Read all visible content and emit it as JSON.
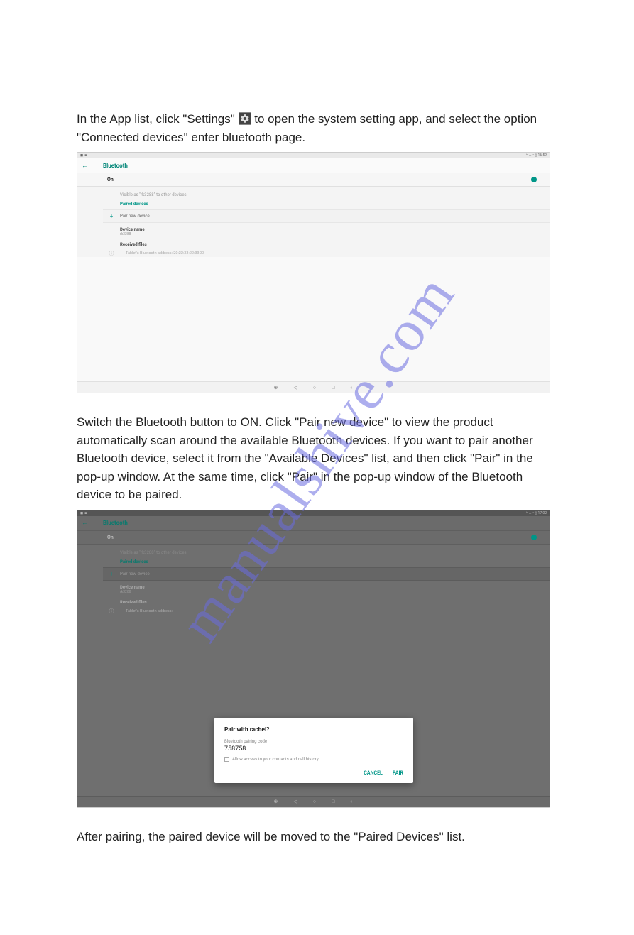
{
  "paragraphs": {
    "p1a": "In the App list, click \"Settings\" ",
    "p1b": " to open the system setting app, and select the option \"Connected devices\" enter bluetooth page.",
    "p2": "Switch the Bluetooth button to ON. Click \"Pair new device\" to view the product automatically scan around the available Bluetooth devices. If you want to pair another Bluetooth device, select it from the \"Available Devices\" list, and then click \"Pair\" in the pop-up window. At the same time, click \"Pair\" in the pop-up window of the Bluetooth device to be paired.",
    "p3": "After pairing, the paired device will be moved to the \"Paired Devices\" list."
  },
  "watermark": "manualshive.com",
  "shot1": {
    "status_time": "16:59",
    "status_ind": "ᵇ ↔ ᶜ ▯",
    "header_title": "Bluetooth",
    "on_label": "On",
    "visible_text": "Visible as \"rk3288\" to other devices",
    "paired_devices_label": "Paired devices",
    "pair_new_device": "Pair new device",
    "device_name_label": "Device name",
    "device_name_value": "rk3288",
    "received_files": "Received files",
    "bt_addr": "Tablet's Bluetooth address: 20:22:33:22:33:33"
  },
  "shot2": {
    "status_time": "17:02",
    "status_ind": "ᵇ ↔ ᶜ ▯",
    "header_title": "Bluetooth",
    "on_label": "On",
    "visible_text": "Visible as \"rk3288\" to other devices",
    "paired_devices_label": "Paired devices",
    "pair_new_device": "Pair new device",
    "device_name_label": "Device name",
    "device_name_value": "rk3288",
    "received_files": "Received files",
    "bt_addr": "Tablet's Bluetooth address:",
    "dialog": {
      "title": "Pair with rachel?",
      "code_label": "Bluetooth pairing code",
      "code": "758758",
      "checkbox": "Allow access to your contacts and call history",
      "cancel": "CANCEL",
      "pair": "PAIR"
    }
  },
  "nav": {
    "b1": "⊕",
    "b2": "◁",
    "b3": "○",
    "b4": "□",
    "b5": "◐"
  }
}
